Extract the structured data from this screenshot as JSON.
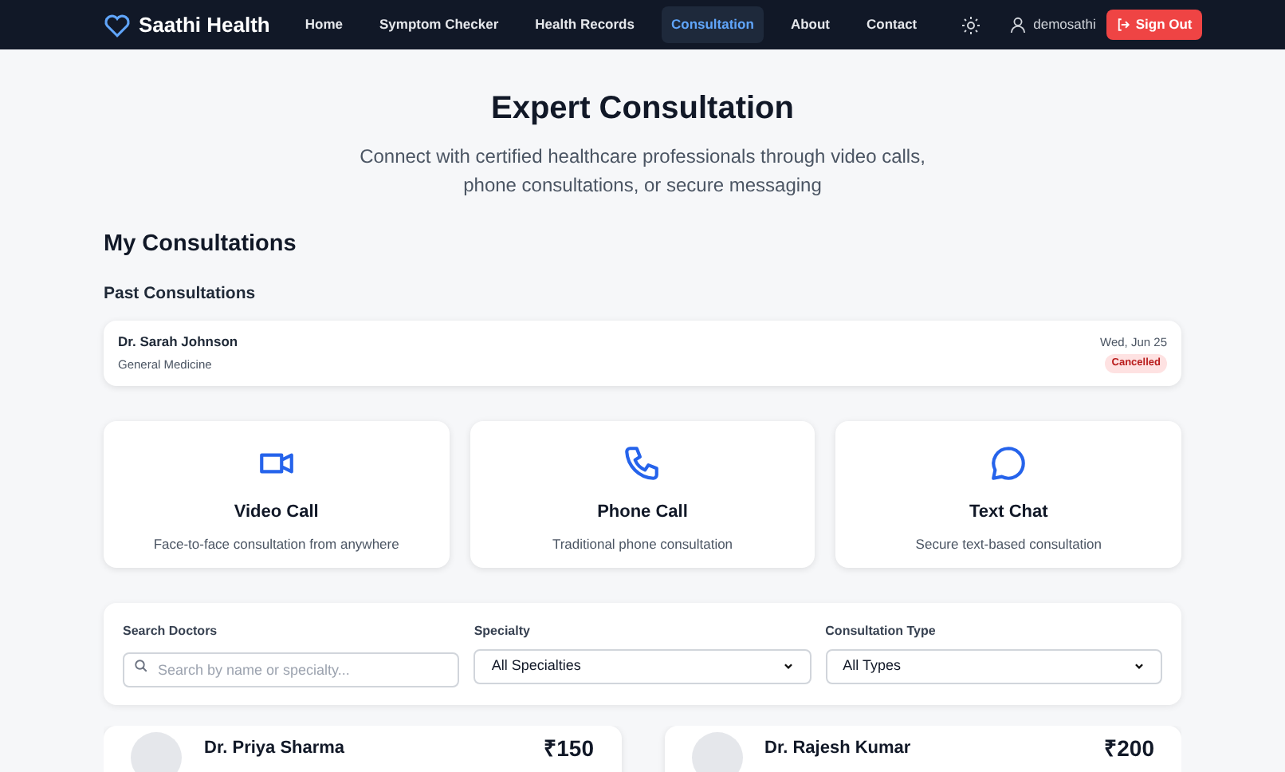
{
  "nav": {
    "brand": "Saathi Health",
    "links": [
      {
        "label": "Home",
        "selected": false
      },
      {
        "label": "Symptom Checker",
        "selected": false
      },
      {
        "label": "Health Records",
        "selected": false
      },
      {
        "label": "Consultation",
        "selected": true
      },
      {
        "label": "About",
        "selected": false
      },
      {
        "label": "Contact",
        "selected": false
      }
    ],
    "user": "demosathi",
    "sign_out": "Sign Out"
  },
  "header": {
    "title": "Expert Consultation",
    "subtitle": "Connect with certified healthcare professionals through video calls, phone consultations, or secure messaging"
  },
  "my_consultations": {
    "title": "My Consultations",
    "section": "Past Consultations",
    "items": [
      {
        "doctor": "Dr. Sarah Johnson",
        "specialty": "General Medicine",
        "date": "Wed, Jun 25",
        "status": "Cancelled"
      }
    ]
  },
  "modes": [
    {
      "kind": "video",
      "title": "Video Call",
      "description": "Face-to-face consultation from anywhere"
    },
    {
      "kind": "phone",
      "title": "Phone Call",
      "description": "Traditional phone consultation"
    },
    {
      "kind": "chat",
      "title": "Text Chat",
      "description": "Secure text-based consultation"
    }
  ],
  "filters": {
    "search": {
      "label": "Search Doctors",
      "placeholder": "Search by name or specialty..."
    },
    "specialty": {
      "label": "Specialty",
      "value": "All Specialties"
    },
    "type": {
      "label": "Consultation Type",
      "value": "All Types"
    }
  },
  "doctors": [
    {
      "name": "Dr. Priya Sharma",
      "fee": "₹150"
    },
    {
      "name": "Dr. Rajesh Kumar",
      "fee": "₹200"
    }
  ]
}
